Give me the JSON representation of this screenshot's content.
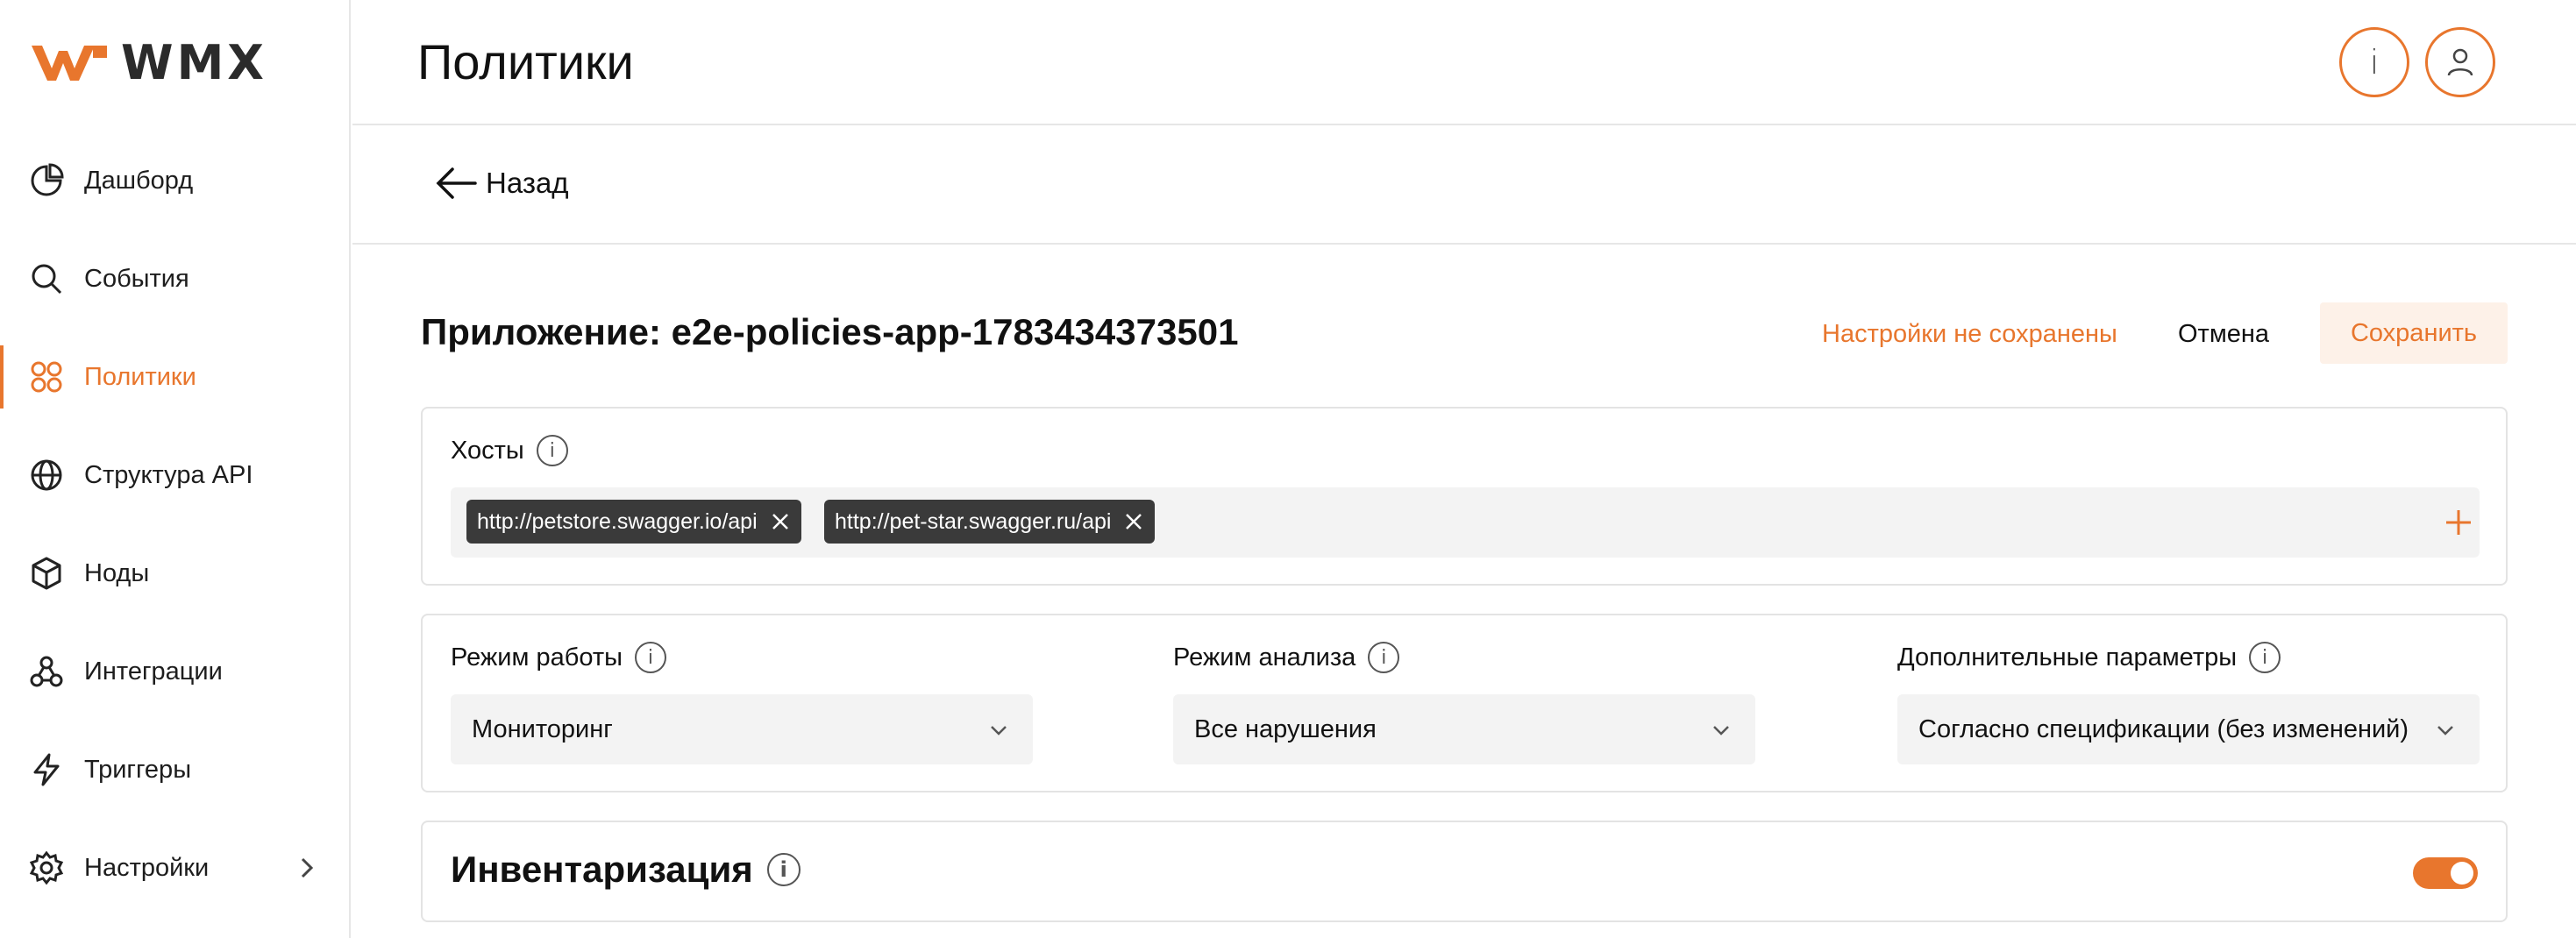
{
  "brand": {
    "name": "WMX",
    "accent": "#e8762d"
  },
  "sidebar": {
    "items": [
      {
        "label": "Дашборд",
        "icon": "pie-chart-icon"
      },
      {
        "label": "События",
        "icon": "search-icon"
      },
      {
        "label": "Политики",
        "icon": "grid-circles-icon",
        "active": true
      },
      {
        "label": "Структура API",
        "icon": "globe-icon"
      },
      {
        "label": "Ноды",
        "icon": "cube-icon"
      },
      {
        "label": "Интеграции",
        "icon": "webhook-icon"
      },
      {
        "label": "Триггеры",
        "icon": "lightning-icon"
      },
      {
        "label": "Настройки",
        "icon": "gear-icon",
        "has_submenu": true
      }
    ]
  },
  "header": {
    "title": "Политики",
    "info_label": "i"
  },
  "back": {
    "label": "Назад"
  },
  "app": {
    "title": "Приложение: e2e-policies-app-1783434373501",
    "unsaved_label": "Настройки не сохранены",
    "cancel_label": "Отмена",
    "save_label": "Сохранить"
  },
  "hosts": {
    "label": "Хосты",
    "chips": [
      "http://petstore.swagger.io/api",
      "http://pet-star.swagger.ru/api"
    ]
  },
  "modes": {
    "work_mode": {
      "label": "Режим работы",
      "value": "Мониторинг"
    },
    "analysis_mode": {
      "label": "Режим анализа",
      "value": "Все нарушения"
    },
    "extra_params": {
      "label": "Дополнительные параметры",
      "value": "Согласно спецификации (без изменений)"
    }
  },
  "inventory": {
    "title": "Инвентаризация",
    "enabled": true
  }
}
